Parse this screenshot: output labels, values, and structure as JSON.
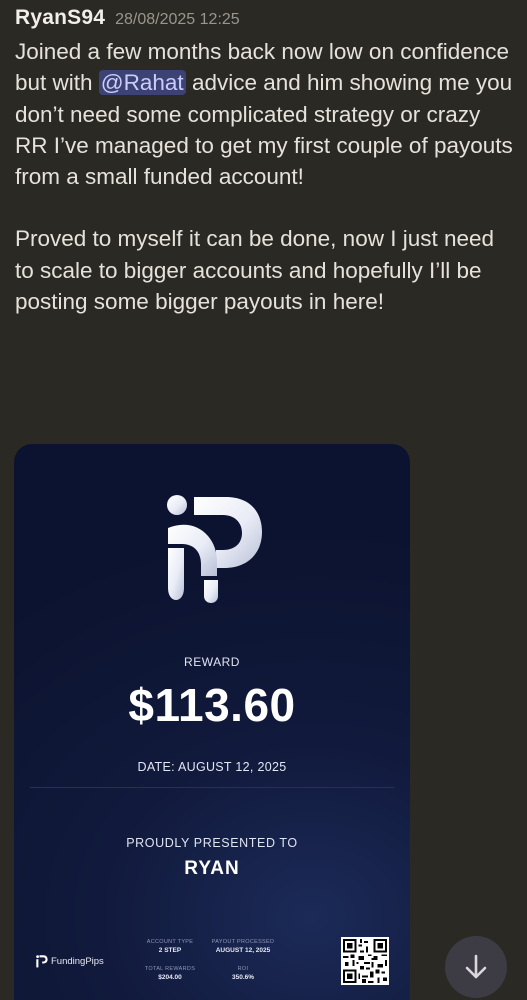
{
  "message": {
    "author": "RyanS94",
    "timestamp": "28/08/2025 12:25",
    "paragraph1_before": "Joined a few months back now low on confidence but with ",
    "mention": "@Rahat",
    "paragraph1_after": " advice and him showing me you don’t need some complicated strategy or crazy RR I’ve managed to get my first couple of payouts from a small funded account!",
    "paragraph2": "Proved to myself it can be done, now I just need to scale to bigger accounts and hopefully I’ll be posting some bigger payouts in here!"
  },
  "card": {
    "reward_label": "REWARD",
    "amount": "$113.60",
    "date_line": "DATE: AUGUST 12, 2025",
    "presented_label": "PROUDLY PRESENTED TO",
    "recipient": "RYAN",
    "brand_name": "FundingPips",
    "account_type_label": "ACCOUNT TYPE",
    "account_type_value": "2 STEP",
    "payout_processed_label": "PAYOUT PROCESSED",
    "payout_processed_value": "AUGUST 12, 2025",
    "total_rewards_label": "TOTAL REWARDS",
    "total_rewards_value": "$204.00",
    "roi_label": "ROI",
    "roi_value": "350.6%"
  },
  "scroll_button": {
    "icon": "arrow-down-icon"
  },
  "colors": {
    "background": "#2b2923",
    "mention_bg": "#3c4274",
    "card_bg": "#111a3c"
  }
}
